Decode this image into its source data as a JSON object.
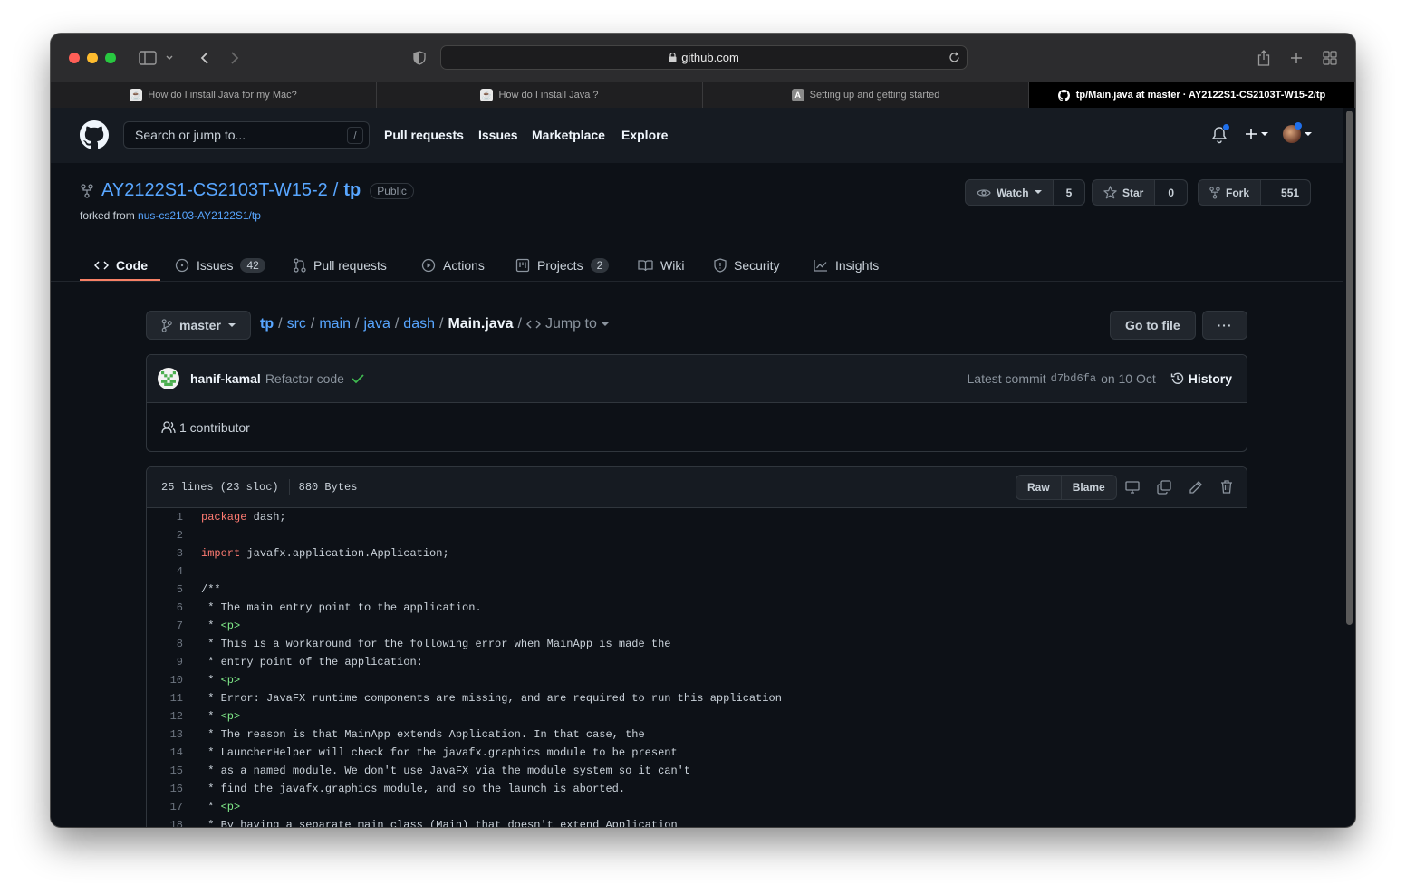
{
  "browser": {
    "url": "github.com",
    "tabs": [
      {
        "title": "How do I install Java for my Mac?",
        "active": false,
        "favicon": "java-icon"
      },
      {
        "title": "How do I install Java ?",
        "active": false,
        "favicon": "java-icon"
      },
      {
        "title": "Setting up and getting started",
        "active": false,
        "favicon": "a-letter-icon"
      },
      {
        "title": "tp/Main.java at master · AY2122S1-CS2103T-W15-2/tp",
        "active": true,
        "favicon": "github-icon"
      }
    ]
  },
  "header": {
    "search_placeholder": "Search or jump to...",
    "search_shortcut": "/",
    "nav": [
      "Pull requests",
      "Issues",
      "Marketplace",
      "Explore"
    ]
  },
  "repo": {
    "owner": "AY2122S1-CS2103T-W15-2",
    "separator": "/",
    "name": "tp",
    "visibility": "Public",
    "forked_label": "forked from",
    "forked_from": "nus-cs2103-AY2122S1/tp",
    "watch_label": "Watch",
    "watch_count": "5",
    "star_label": "Star",
    "star_count": "0",
    "fork_label": "Fork",
    "fork_count": "551",
    "tabs": [
      {
        "label": "Code",
        "count": "",
        "active": true,
        "icon": "code-icon"
      },
      {
        "label": "Issues",
        "count": "42",
        "active": false,
        "icon": "issue-icon"
      },
      {
        "label": "Pull requests",
        "count": "",
        "active": false,
        "icon": "pull-request-icon"
      },
      {
        "label": "Actions",
        "count": "",
        "active": false,
        "icon": "play-icon"
      },
      {
        "label": "Projects",
        "count": "2",
        "active": false,
        "icon": "project-icon"
      },
      {
        "label": "Wiki",
        "count": "",
        "active": false,
        "icon": "book-icon"
      },
      {
        "label": "Security",
        "count": "",
        "active": false,
        "icon": "shield-icon"
      },
      {
        "label": "Insights",
        "count": "",
        "active": false,
        "icon": "graph-icon"
      }
    ]
  },
  "file_nav": {
    "branch": "master",
    "path": [
      "tp",
      "src",
      "main",
      "java",
      "dash"
    ],
    "file": "Main.java",
    "jump_to": "Jump to",
    "go_to_file": "Go to file",
    "more": "···"
  },
  "commit": {
    "author": "hanif-kamal",
    "message": "Refactor code",
    "latest_label": "Latest commit",
    "sha": "d7bd6fa",
    "date": "on 10 Oct",
    "history": "History",
    "contributors": "1 contributor"
  },
  "file": {
    "lines_info": "25 lines (23 sloc)",
    "size": "880 Bytes",
    "raw": "Raw",
    "blame": "Blame",
    "code": [
      [
        {
          "t": "package",
          "c": "kw"
        },
        {
          "t": " dash;",
          "c": ""
        }
      ],
      [],
      [
        {
          "t": "import",
          "c": "kw"
        },
        {
          "t": " javafx.application.Application;",
          "c": ""
        }
      ],
      [],
      [
        {
          "t": "/**",
          "c": ""
        }
      ],
      [
        {
          "t": " * The main entry point to the application.",
          "c": ""
        }
      ],
      [
        {
          "t": " * ",
          "c": ""
        },
        {
          "t": "<p>",
          "c": "tag"
        }
      ],
      [
        {
          "t": " * This is a workaround for the following error when MainApp is made the",
          "c": ""
        }
      ],
      [
        {
          "t": " * entry point of the application:",
          "c": ""
        }
      ],
      [
        {
          "t": " * ",
          "c": ""
        },
        {
          "t": "<p>",
          "c": "tag"
        }
      ],
      [
        {
          "t": " * Error: JavaFX runtime components are missing, and are required to run this application",
          "c": ""
        }
      ],
      [
        {
          "t": " * ",
          "c": ""
        },
        {
          "t": "<p>",
          "c": "tag"
        }
      ],
      [
        {
          "t": " * The reason is that MainApp extends Application. In that case, the",
          "c": ""
        }
      ],
      [
        {
          "t": " * LauncherHelper will check for the javafx.graphics module to be present",
          "c": ""
        }
      ],
      [
        {
          "t": " * as a named module. We don't use JavaFX via the module system so it can't",
          "c": ""
        }
      ],
      [
        {
          "t": " * find the javafx.graphics module, and so the launch is aborted.",
          "c": ""
        }
      ],
      [
        {
          "t": " * ",
          "c": ""
        },
        {
          "t": "<p>",
          "c": "tag"
        }
      ],
      [
        {
          "t": " * By having a separate main class (Main) that doesn't extend Application",
          "c": ""
        }
      ]
    ]
  },
  "colors": {
    "link": "#58a6ff",
    "keyword": "#ff7b72",
    "tag": "#7ee787",
    "active_tab_underline": "#f78166",
    "notification_dot": "#1f6feb"
  }
}
